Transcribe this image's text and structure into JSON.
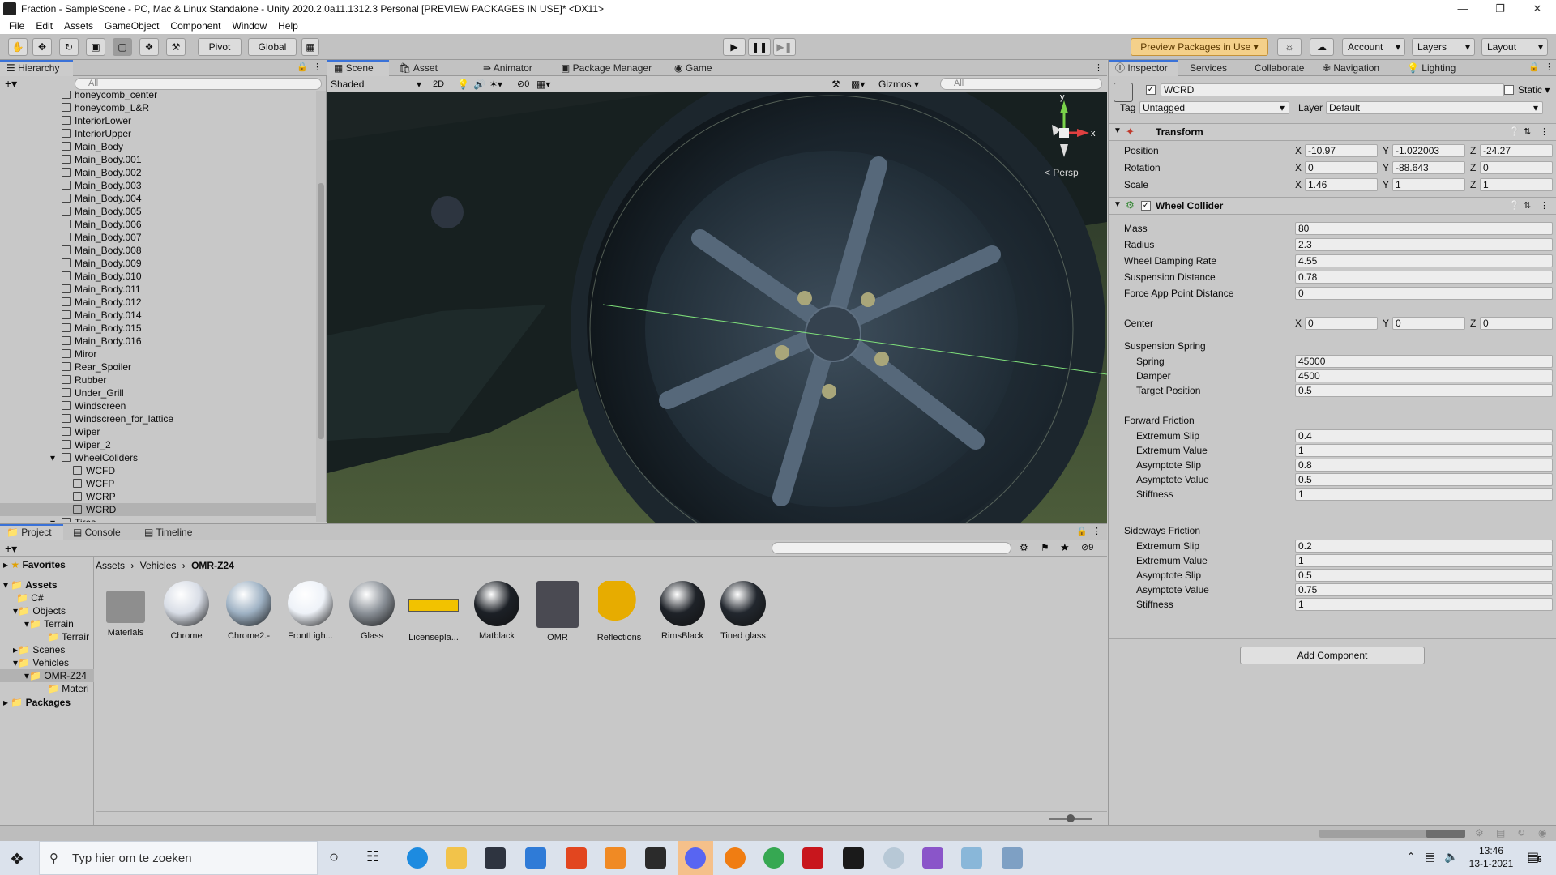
{
  "window": {
    "title": "Fraction - SampleScene - PC, Mac & Linux Standalone - Unity 2020.2.0a11.1312.3 Personal [PREVIEW PACKAGES IN USE]* <DX11>"
  },
  "menu": [
    "File",
    "Edit",
    "Assets",
    "GameObject",
    "Component",
    "Window",
    "Help"
  ],
  "toolbar": {
    "pivot": "Pivot",
    "global": "Global",
    "preview_packages": "Preview Packages in Use",
    "account": "Account",
    "layers": "Layers",
    "layout": "Layout"
  },
  "hierarchy": {
    "tab": "Hierarchy",
    "search_placeholder": "All",
    "items": [
      {
        "label": "honeycomb_center"
      },
      {
        "label": "honeycomb_L&R"
      },
      {
        "label": "InteriorLower"
      },
      {
        "label": "InteriorUpper"
      },
      {
        "label": "Main_Body"
      },
      {
        "label": "Main_Body.001"
      },
      {
        "label": "Main_Body.002"
      },
      {
        "label": "Main_Body.003"
      },
      {
        "label": "Main_Body.004"
      },
      {
        "label": "Main_Body.005"
      },
      {
        "label": "Main_Body.006"
      },
      {
        "label": "Main_Body.007"
      },
      {
        "label": "Main_Body.008"
      },
      {
        "label": "Main_Body.009"
      },
      {
        "label": "Main_Body.010"
      },
      {
        "label": "Main_Body.011"
      },
      {
        "label": "Main_Body.012"
      },
      {
        "label": "Main_Body.014"
      },
      {
        "label": "Main_Body.015"
      },
      {
        "label": "Main_Body.016"
      },
      {
        "label": "Miror"
      },
      {
        "label": "Rear_Spoiler"
      },
      {
        "label": "Rubber"
      },
      {
        "label": "Under_Grill"
      },
      {
        "label": "Windscreen"
      },
      {
        "label": "Windscreen_for_lattice"
      },
      {
        "label": "Wiper"
      },
      {
        "label": "Wiper_2"
      },
      {
        "label": "WheelColiders"
      },
      {
        "label": "WCFD"
      },
      {
        "label": "WCFP"
      },
      {
        "label": "WCRP"
      },
      {
        "label": "WCRD"
      },
      {
        "label": "Tires"
      }
    ]
  },
  "scene": {
    "tabs": [
      "Scene",
      "Asset Store",
      "Animator",
      "Package Manager",
      "Game"
    ],
    "shading": "Shaded",
    "mode_2d": "2D",
    "hidden_count": "0",
    "gizmos": "Gizmos",
    "search_placeholder": "All",
    "persp": "< Persp",
    "gizmo_x": "x",
    "gizmo_y": "y"
  },
  "inspector": {
    "tabs": [
      "Inspector",
      "Services",
      "Collaborate",
      "Navigation",
      "Lighting"
    ],
    "object_name": "WCRD",
    "static": "Static",
    "tag_label": "Tag",
    "tag_value": "Untagged",
    "layer_label": "Layer",
    "layer_value": "Default",
    "transform": {
      "title": "Transform",
      "position_label": "Position",
      "rotation_label": "Rotation",
      "scale_label": "Scale",
      "position": {
        "x": "-10.97",
        "y": "-1.022003",
        "z": "-24.27"
      },
      "rotation": {
        "x": "0",
        "y": "-88.643",
        "z": "0"
      },
      "scale": {
        "x": "1.46",
        "y": "1",
        "z": "1"
      }
    },
    "wheel_collider": {
      "title": "Wheel Collider",
      "fields": [
        {
          "label": "Mass",
          "value": "80"
        },
        {
          "label": "Radius",
          "value": "2.3"
        },
        {
          "label": "Wheel Damping Rate",
          "value": "4.55"
        },
        {
          "label": "Suspension Distance",
          "value": "0.78"
        },
        {
          "label": "Force App Point Distance",
          "value": "0"
        }
      ],
      "center_label": "Center",
      "center": {
        "x": "0",
        "y": "0",
        "z": "0"
      },
      "suspension_spring": {
        "title": "Suspension Spring",
        "fields": [
          {
            "label": "Spring",
            "value": "45000"
          },
          {
            "label": "Damper",
            "value": "4500"
          },
          {
            "label": "Target Position",
            "value": "0.5"
          }
        ]
      },
      "forward_friction": {
        "title": "Forward Friction",
        "fields": [
          {
            "label": "Extremum Slip",
            "value": "0.4"
          },
          {
            "label": "Extremum Value",
            "value": "1"
          },
          {
            "label": "Asymptote Slip",
            "value": "0.8"
          },
          {
            "label": "Asymptote Value",
            "value": "0.5"
          },
          {
            "label": "Stiffness",
            "value": "1"
          }
        ]
      },
      "sideways_friction": {
        "title": "Sideways Friction",
        "fields": [
          {
            "label": "Extremum Slip",
            "value": "0.2"
          },
          {
            "label": "Extremum Value",
            "value": "1"
          },
          {
            "label": "Asymptote Slip",
            "value": "0.5"
          },
          {
            "label": "Asymptote Value",
            "value": "0.75"
          },
          {
            "label": "Stiffness",
            "value": "1"
          }
        ]
      }
    },
    "add_component": "Add Component"
  },
  "project": {
    "tabs": [
      "Project",
      "Console",
      "Timeline"
    ],
    "hidden_count": "9",
    "tree": {
      "favorites": "Favorites",
      "assets": "Assets",
      "csharp": "C#",
      "objects": "Objects",
      "terrain": "Terrain",
      "terrain_child": "Terrair",
      "scenes": "Scenes",
      "vehicles": "Vehicles",
      "omr": "OMR-Z24",
      "materials": "Materi",
      "packages": "Packages"
    },
    "breadcrumb": [
      "Assets",
      "Vehicles",
      "OMR-Z24"
    ],
    "assets": [
      {
        "label": "Materials",
        "kind": "folder"
      },
      {
        "label": "Chrome",
        "kind": "sphere",
        "color": "#d8dde6"
      },
      {
        "label": "Chrome2.-",
        "kind": "sphere",
        "color": "#9fb2c4"
      },
      {
        "label": "FrontLigh...",
        "kind": "sphere",
        "color": "#eef2f8"
      },
      {
        "label": "Glass",
        "kind": "sphere",
        "color": "#8a9097"
      },
      {
        "label": "Licensepla...",
        "kind": "plate",
        "color": "#f2c200"
      },
      {
        "label": "Matblack",
        "kind": "sphere",
        "color": "#1c2026"
      },
      {
        "label": "OMR",
        "kind": "model",
        "color": "#3a3f48"
      },
      {
        "label": "Reflections",
        "kind": "probe",
        "color": "#e7ac00"
      },
      {
        "label": "RimsBlack",
        "kind": "sphere",
        "color": "#1e2228"
      },
      {
        "label": "Tined glass",
        "kind": "sphere",
        "color": "#22272e"
      }
    ]
  },
  "taskbar": {
    "search_placeholder": "Typ hier om te zoeken",
    "time": "13:46",
    "date": "13-1-2021",
    "notification_count": "5"
  }
}
